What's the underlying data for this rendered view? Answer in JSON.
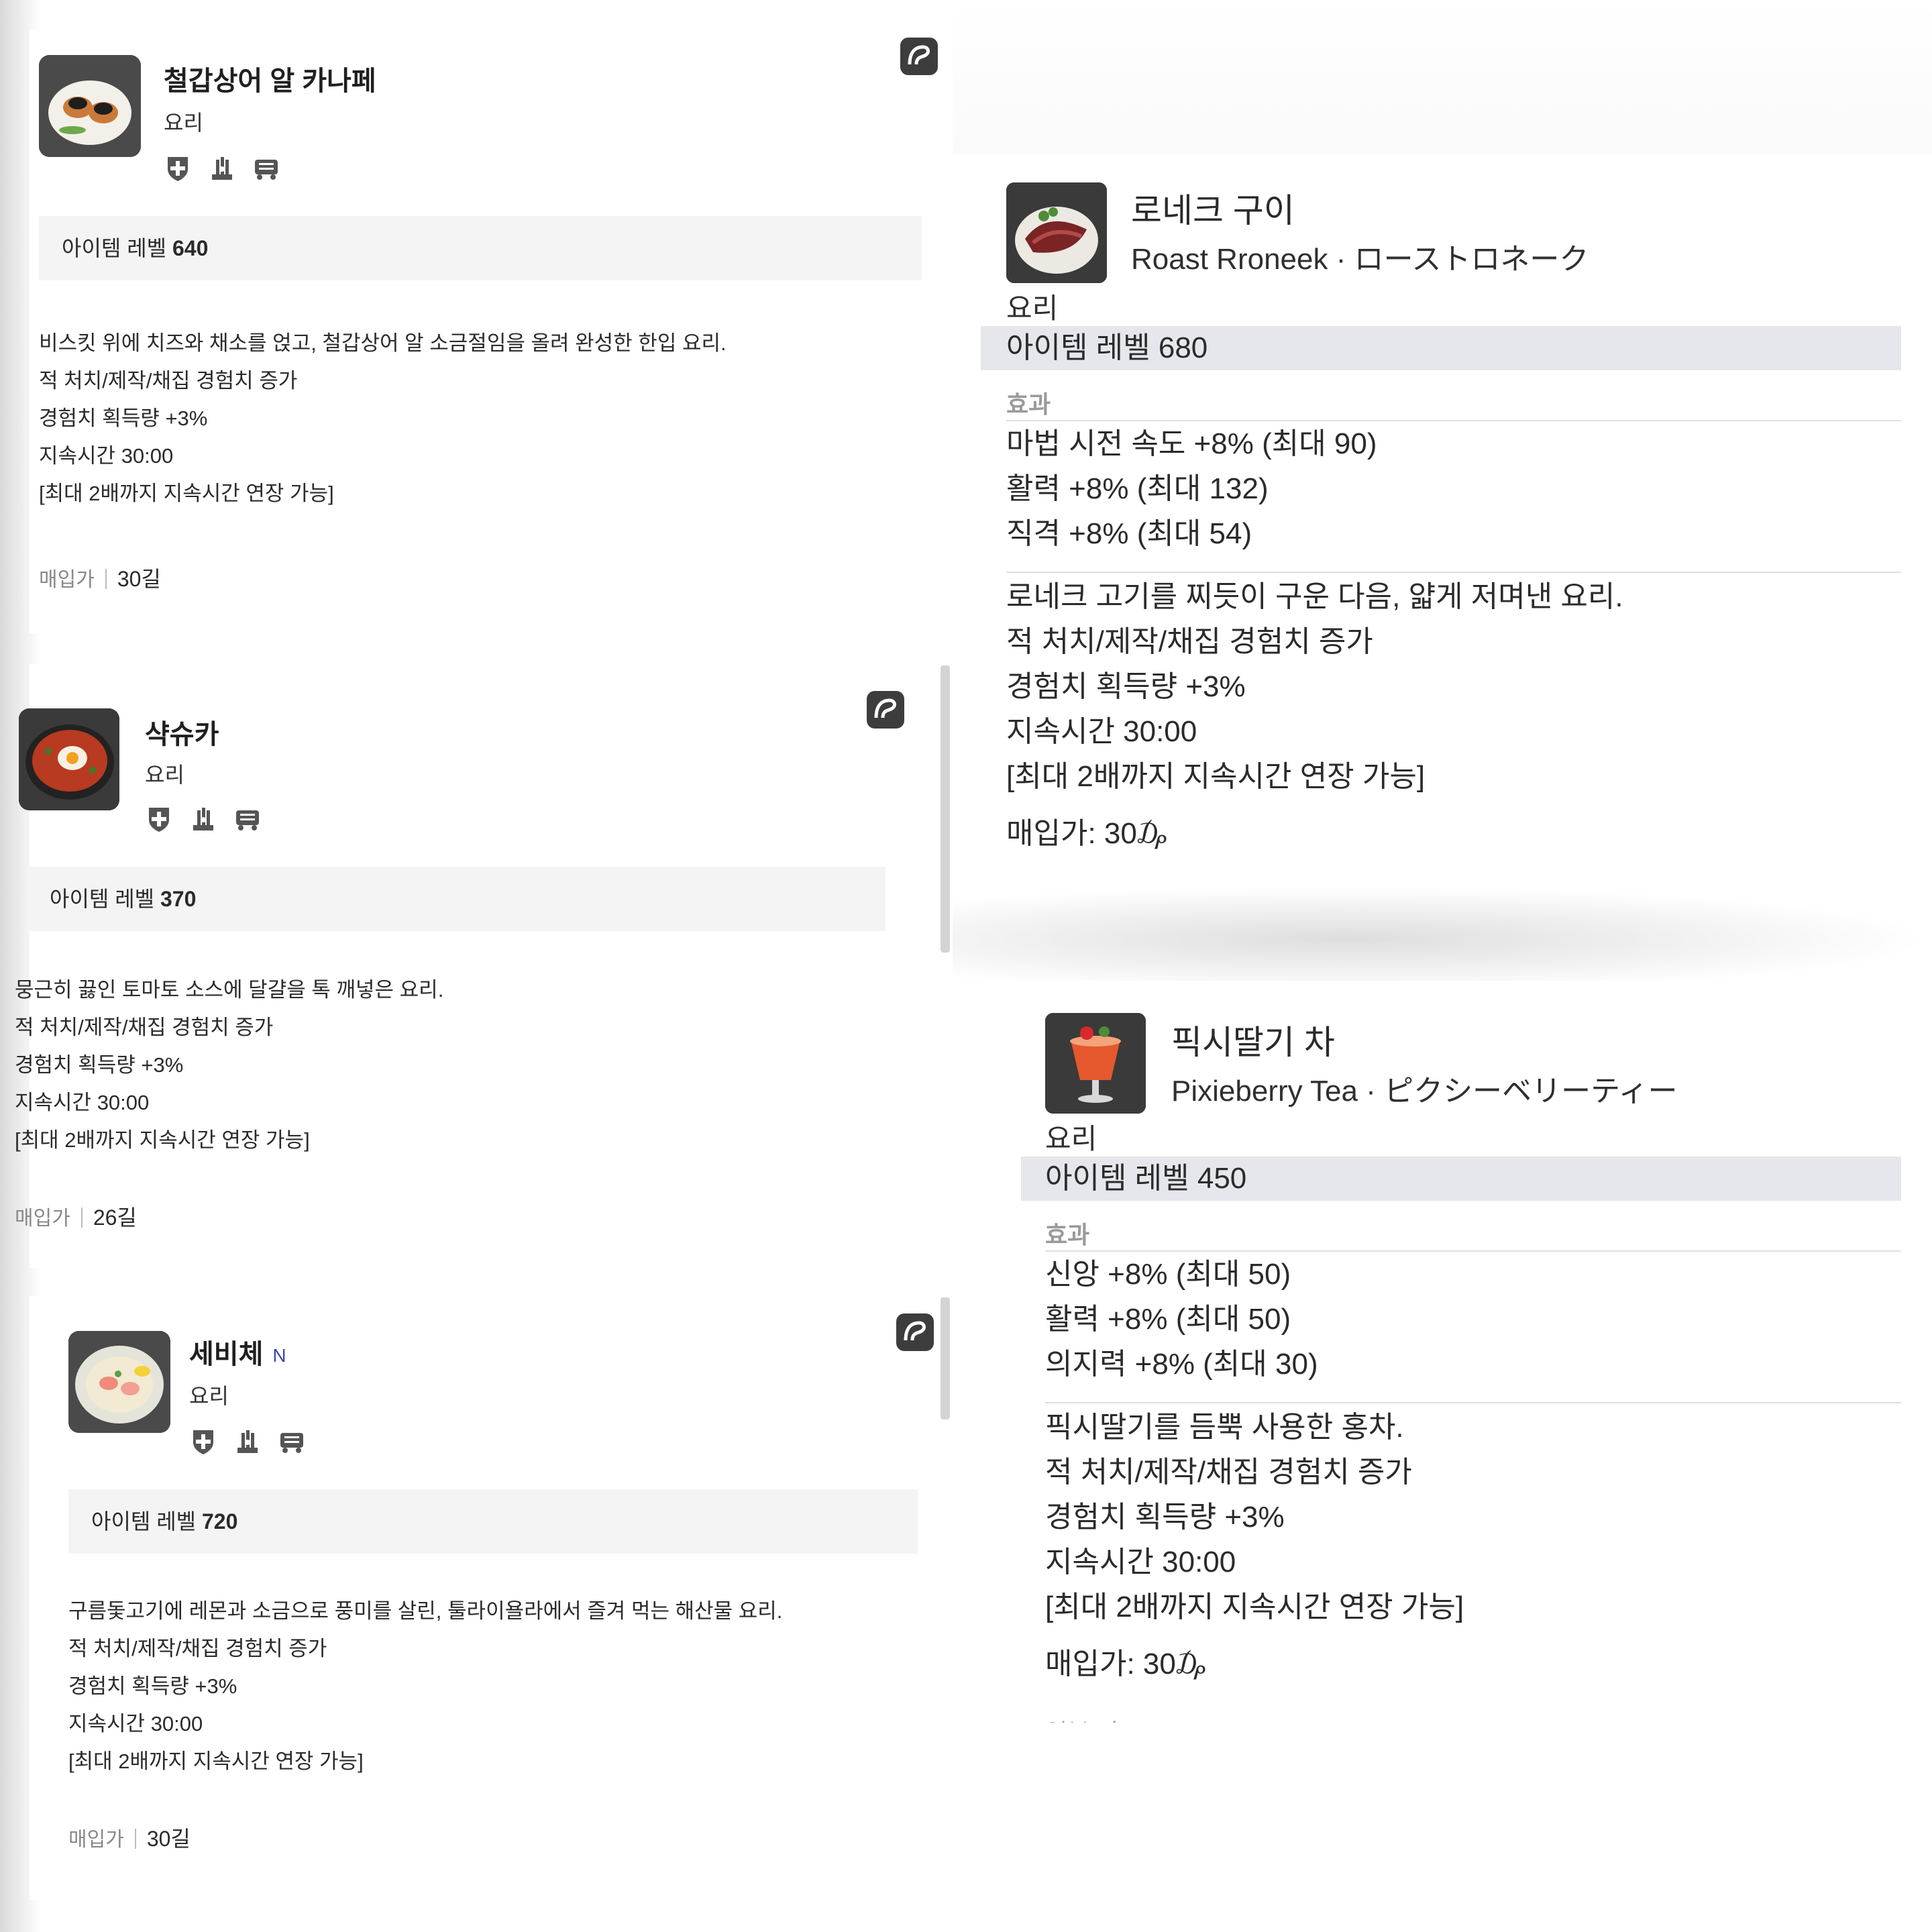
{
  "left_cards": [
    {
      "name": "철갑상어 알 카나페",
      "category": "요리",
      "level_label": "아이템 레벨",
      "level_value": "640",
      "description": [
        "비스킷 위에 치즈와 채소를 얹고, 철갑상어 알 소금절임을 올려 완성한 한입 요리.",
        "적 처치/제작/채집 경험치 증가",
        "경험치 획득량 +3%",
        "지속시간 30:00",
        "[최대 2배까지 지속시간 연장 가능]"
      ],
      "price_label": "매입가",
      "price_value": "30길"
    },
    {
      "name": "샥슈카",
      "category": "요리",
      "level_label": "아이템 레벨",
      "level_value": "370",
      "description": [
        "뭉근히 끓인 토마토 소스에 달걀을 톡 깨넣은 요리.",
        "적 처치/제작/채집 경험치 증가",
        "경험치 획득량 +3%",
        "지속시간 30:00",
        "[최대 2배까지 지속시간 연장 가능]"
      ],
      "price_label": "매입가",
      "price_value": "26길"
    },
    {
      "name": "세비체",
      "badge": "N",
      "category": "요리",
      "level_label": "아이템 레벨",
      "level_value": "720",
      "description": [
        "구름돛고기에 레몬과 소금으로 풍미를 살린, 툴라이욜라에서 즐겨 먹는 해산물 요리.",
        "적 처치/제작/채집 경험치 증가",
        "경험치 획득량 +3%",
        "지속시간 30:00",
        "[최대 2배까지 지속시간 연장 가능]"
      ],
      "price_label": "매입가",
      "price_value": "30길"
    }
  ],
  "right_cards": [
    {
      "title": "로네크 구이",
      "subtitle": "Roast Rroneek · ローストロネーク",
      "category": "요리",
      "level": "아이템 레벨 680",
      "effects_label": "효과",
      "effects": [
        "마법 시전 속도 +8% (최대 90)",
        "활력 +8% (최대 132)",
        "직격 +8% (최대 54)"
      ],
      "description": [
        "로네크 고기를 찌듯이 구운 다음, 얇게 저며낸 요리.",
        "적 처치/제작/채집 경험치 증가",
        "경험치 획득량 +3%",
        "지속시간 30:00",
        "[최대 2배까지 지속시간 연장 가능]"
      ],
      "buy": "매입가: 30₯"
    },
    {
      "title": "픽시딸기 차",
      "subtitle": "Pixieberry Tea · ピクシーベリーティー",
      "category": "요리",
      "level": "아이템 레벨 450",
      "effects_label": "효과",
      "effects": [
        "신앙 +8% (최대 50)",
        "활력 +8% (최대 50)",
        "의지력 +8% (최대 30)"
      ],
      "description": [
        "픽시딸기를 듬뿍 사용한 홍차.",
        "적 처치/제작/채집 경험치 증가",
        "경험치 획득량 +3%",
        "지속시간 30:00",
        "[최대 2배까지 지속시간 연장 가능]"
      ],
      "buy": "매입가: 30₯",
      "cut_off_label": "입부 키그"
    }
  ],
  "icons": [
    "shield-plus-icon",
    "crafter-hand-icon",
    "gatherer-cart-icon",
    "wiki-logo-icon"
  ],
  "colors": {
    "level_bar_left": "#f4f4f4",
    "level_bar_right": "#e6e7ec",
    "badge_n": "#3a48b0"
  }
}
